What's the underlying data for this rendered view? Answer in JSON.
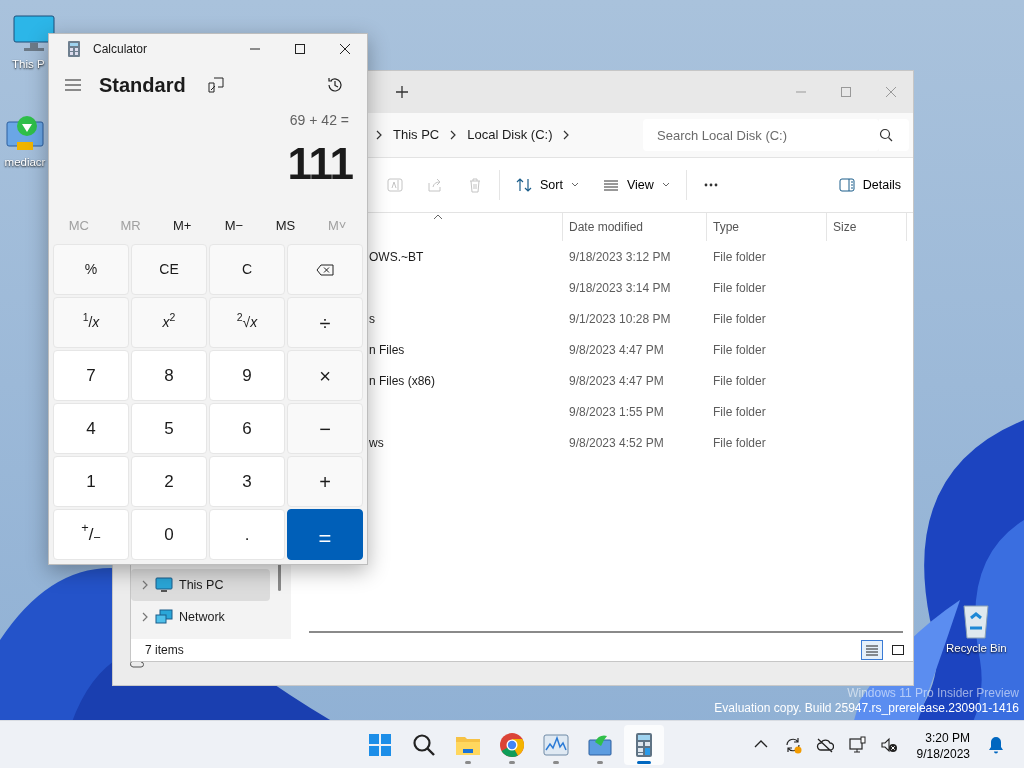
{
  "desktop_icons": [
    {
      "label": "This P",
      "kind": "monitor"
    },
    {
      "label": "mediacr",
      "kind": "installer"
    },
    {
      "label": "Recycle Bin",
      "kind": "recycle"
    }
  ],
  "explorer": {
    "breadcrumbs": [
      "This PC",
      "Local Disk (C:)"
    ],
    "search": {
      "placeholder": "Search Local Disk (C:)"
    },
    "toolbar": [
      {
        "kind": "rename",
        "disabled": true
      },
      {
        "kind": "share",
        "disabled": true
      },
      {
        "kind": "delete",
        "disabled": true
      },
      {
        "kind": "sort",
        "label": "Sort"
      },
      {
        "kind": "view",
        "label": "View"
      },
      {
        "kind": "more"
      },
      {
        "kind": "details",
        "label": "Details"
      }
    ],
    "columns": [
      "Date modified",
      "Type",
      "Size"
    ],
    "rows": [
      {
        "name": "OWS.~BT",
        "date": "9/18/2023 3:12 PM",
        "type": "File folder"
      },
      {
        "date": "9/18/2023 3:14 PM",
        "type": "File folder"
      },
      {
        "name": "s",
        "date": "9/1/2023 10:28 PM",
        "type": "File folder"
      },
      {
        "name": "n Files",
        "date": "9/8/2023 4:47 PM",
        "type": "File folder"
      },
      {
        "name": "n Files (x86)",
        "date": "9/8/2023 4:47 PM",
        "type": "File folder"
      },
      {
        "date": "9/8/2023 1:55 PM",
        "type": "File folder"
      },
      {
        "name": "ws",
        "date": "9/8/2023 4:52 PM",
        "type": "File folder"
      }
    ],
    "nav": [
      {
        "label": "This PC",
        "kind": "pc",
        "selected": true
      },
      {
        "label": "Network",
        "kind": "network",
        "selected": false
      }
    ],
    "status": "7 items",
    "views": [
      {
        "kind": "details",
        "selected": true
      },
      {
        "kind": "tiles",
        "selected": false
      }
    ]
  },
  "calculator": {
    "title": "Calculator",
    "mode": "Standard",
    "expression": "69 + 42 =",
    "result": "111",
    "memory": [
      {
        "label": "MC",
        "disabled": true
      },
      {
        "label": "MR",
        "disabled": true
      },
      {
        "label": "M+",
        "disabled": false
      },
      {
        "label": "M−",
        "disabled": false
      },
      {
        "label": "MS",
        "disabled": false
      },
      {
        "label": "M˅",
        "disabled": true
      }
    ],
    "keys": [
      {
        "label": "%",
        "kind": "func"
      },
      {
        "label": "CE",
        "kind": "func"
      },
      {
        "label": "C",
        "kind": "func"
      },
      {
        "kind": "backspace"
      },
      {
        "label": "$^{1}$/*x*",
        "kind": "func"
      },
      {
        "label": "*x*$^{2}$",
        "kind": "func"
      },
      {
        "label": "$^{2}$√*x*",
        "kind": "func"
      },
      {
        "label": "÷",
        "kind": "op"
      },
      {
        "label": "7",
        "kind": "digit"
      },
      {
        "label": "8",
        "kind": "digit"
      },
      {
        "label": "9",
        "kind": "digit"
      },
      {
        "label": "×",
        "kind": "op"
      },
      {
        "label": "4",
        "kind": "digit"
      },
      {
        "label": "5",
        "kind": "digit"
      },
      {
        "label": "6",
        "kind": "digit"
      },
      {
        "label": "−",
        "kind": "op"
      },
      {
        "label": "1",
        "kind": "digit"
      },
      {
        "label": "2",
        "kind": "digit"
      },
      {
        "label": "3",
        "kind": "digit"
      },
      {
        "label": "+",
        "kind": "op"
      },
      {
        "label": "$^{+}$/$_{−}$",
        "kind": "digit"
      },
      {
        "label": "0",
        "kind": "digit"
      },
      {
        "label": ".",
        "kind": "digit"
      },
      {
        "label": "=",
        "kind": "equals"
      }
    ]
  },
  "watermark": [
    "Windows 11 Pro Insider Preview",
    "Evaluation copy. Build 25947.rs_prerelease.230901-1416"
  ],
  "taskbar": {
    "apps": [
      {
        "kind": "start",
        "running": false,
        "active": false
      },
      {
        "kind": "search",
        "running": false,
        "active": false
      },
      {
        "kind": "explorer",
        "running": true,
        "active": false
      },
      {
        "kind": "chrome",
        "running": true,
        "active": false
      },
      {
        "kind": "perfmon",
        "running": true,
        "active": false
      },
      {
        "kind": "mediatool",
        "running": true,
        "active": false
      },
      {
        "kind": "calculator",
        "running": true,
        "active": true
      }
    ],
    "tray": [
      {
        "kind": "chevron"
      },
      {
        "kind": "sync"
      },
      {
        "kind": "cloud-off"
      },
      {
        "kind": "network"
      },
      {
        "kind": "mute"
      }
    ],
    "time": "3:20 PM",
    "date": "9/18/2023"
  }
}
